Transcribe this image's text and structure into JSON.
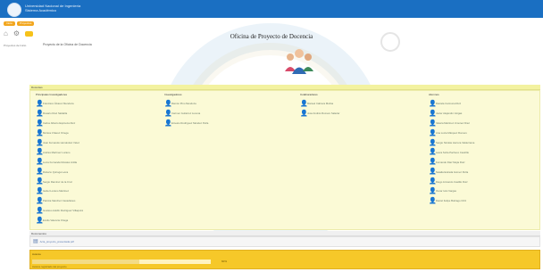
{
  "header": {
    "logo_text_1": "Universidad Nacional de Ingeniería",
    "logo_text_2": "Sistema Académico",
    "pills": [
      "Inicio",
      "Proyectos"
    ],
    "page_title": "Oficina de Proyecto de Docencia",
    "breadcrumb": "Proyecto de la Oficina de Docencia",
    "sidebar_label": "Proyectos de Inicio"
  },
  "participants": {
    "section_label": "Docentes",
    "columns": [
      {
        "title": "Principales Investigadores",
        "members": [
          "Francisco Álvarez Mendoza",
          "Rosario Díaz Saldaña",
          "Carlos Alberto Espinoza Ruiz",
          "Mónica Chávez Ortega",
          "Juan Fernando Hernández Vélez",
          "Andrés Martínez Lozano",
          "Lucía Fernanda Morales Ardila",
          "Roberto Quiroga Leiva",
          "Sergio Ramírez de la Cruz",
          "Isabel Lozano Martínez",
          "Patricia Sánchez Castellanos",
          "Gustavo Adolfo Rodríguez Villaquirá",
          "Emilio Valencia Ortega"
        ]
      },
      {
        "title": "Investigadores",
        "members": [
          "Ramón Pino Mendoza",
          "Carmen Gutiérrez Lucena",
          "Ernesto Rodríguez Méndez Peña"
        ]
      },
      {
        "title": "Colaboradores",
        "members": [
          "Manuel Cabrera Molina",
          "José Andrés Romero Salazar"
        ]
      },
      {
        "title": "Alumnos",
        "members": [
          "Daniela Carmona Ruiz",
          "Javier Alejandro Vargas",
          "Valeria Martínez Jiménez Díaz",
          "Ana Lucía Márquez Romero",
          "Sergio Nicolás Herrera Valderrama",
          "Laura Sofía Pacheco Castrillo",
          "Fernando Díaz Mejía Ruiz",
          "Natalia Estrada Gómez Peña",
          "Diego Armando Castillo Ruiz",
          "Oscar Iván Vargas",
          "Daniel Felipe Buitrago Ortiz"
        ]
      }
    ]
  },
  "documents": {
    "section_label": "Documentos",
    "file_name": "Acta_proyecto_presentada.pdf"
  },
  "progress": {
    "section_label": "Avance",
    "percent": 60,
    "value_label": "60%",
    "subtext": "Avance registrado del proyecto"
  }
}
